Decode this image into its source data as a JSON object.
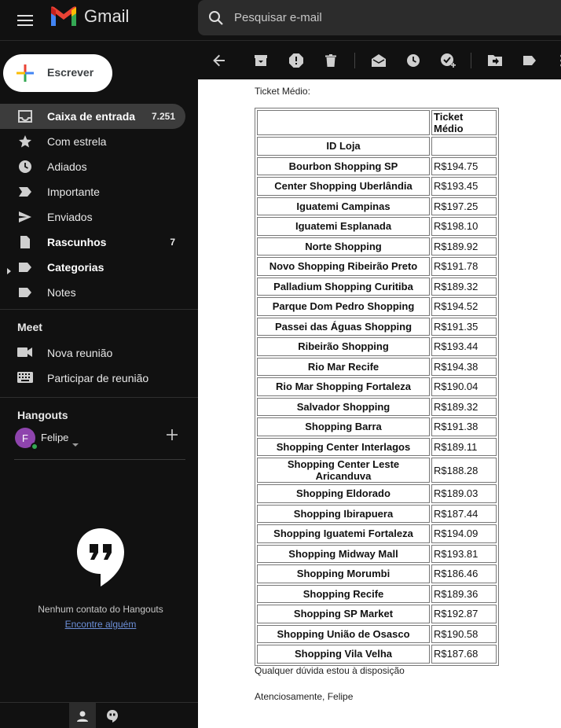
{
  "header": {
    "app_name": "Gmail",
    "search_placeholder": "Pesquisar e-mail"
  },
  "compose": {
    "label": "Escrever"
  },
  "nav": {
    "items": [
      {
        "label": "Caixa de entrada",
        "count": "7.251",
        "icon": "inbox-icon",
        "active": true,
        "bold": true
      },
      {
        "label": "Com estrela",
        "count": "",
        "icon": "star-icon"
      },
      {
        "label": "Adiados",
        "count": "",
        "icon": "clock-icon"
      },
      {
        "label": "Importante",
        "count": "",
        "icon": "important-icon"
      },
      {
        "label": "Enviados",
        "count": "",
        "icon": "send-icon"
      },
      {
        "label": "Rascunhos",
        "count": "7",
        "icon": "draft-icon",
        "bold": true
      },
      {
        "label": "Categorias",
        "count": "",
        "icon": "label-icon",
        "bold": true
      },
      {
        "label": "Notes",
        "count": "",
        "icon": "label-icon"
      }
    ]
  },
  "meet": {
    "title": "Meet",
    "new_meeting": "Nova reunião",
    "join_meeting": "Participar de reunião"
  },
  "hangouts": {
    "title": "Hangouts",
    "user_initial": "F",
    "user_name": "Felipe",
    "no_contacts": "Nenhum contato do Hangouts",
    "find_someone": "Encontre alguém"
  },
  "email": {
    "intro": "Ticket Médio:",
    "table_header_value": "Ticket Médio",
    "table_header_id": "ID Loja",
    "rows": [
      {
        "store": "Bourbon Shopping SP",
        "value": "R$194.75"
      },
      {
        "store": "Center Shopping Uberlândia",
        "value": "R$193.45"
      },
      {
        "store": "Iguatemi Campinas",
        "value": "R$197.25"
      },
      {
        "store": "Iguatemi Esplanada",
        "value": "R$198.10"
      },
      {
        "store": "Norte Shopping",
        "value": "R$189.92"
      },
      {
        "store": "Novo Shopping Ribeirão Preto",
        "value": "R$191.78"
      },
      {
        "store": "Palladium Shopping Curitiba",
        "value": "R$189.32"
      },
      {
        "store": "Parque Dom Pedro Shopping",
        "value": "R$194.52"
      },
      {
        "store": "Passei das Águas Shopping",
        "value": "R$191.35"
      },
      {
        "store": "Ribeirão Shopping",
        "value": "R$193.44"
      },
      {
        "store": "Rio Mar Recife",
        "value": "R$194.38"
      },
      {
        "store": "Rio Mar Shopping Fortaleza",
        "value": "R$190.04"
      },
      {
        "store": "Salvador Shopping",
        "value": "R$189.32"
      },
      {
        "store": "Shopping Barra",
        "value": "R$191.38"
      },
      {
        "store": "Shopping Center Interlagos",
        "value": "R$189.11"
      },
      {
        "store": "Shopping Center Leste Aricanduva",
        "value": "R$188.28"
      },
      {
        "store": "Shopping Eldorado",
        "value": "R$189.03"
      },
      {
        "store": "Shopping Ibirapuera",
        "value": "R$187.44"
      },
      {
        "store": "Shopping Iguatemi Fortaleza",
        "value": "R$194.09"
      },
      {
        "store": "Shopping Midway Mall",
        "value": "R$193.81"
      },
      {
        "store": "Shopping Morumbi",
        "value": "R$186.46"
      },
      {
        "store": "Shopping Recife",
        "value": "R$189.36"
      },
      {
        "store": "Shopping SP Market",
        "value": "R$192.87"
      },
      {
        "store": "Shopping União de Osasco",
        "value": "R$190.58"
      },
      {
        "store": "Shopping Vila Velha",
        "value": "R$187.68"
      }
    ],
    "closing_line": "Qualquer dúvida estou à disposição",
    "signature": "Atenciosamente, Felipe"
  },
  "colors": {
    "background": "#111111",
    "active_item": "#3c3c3c",
    "avatar": "#8e44ad",
    "online": "#34a853",
    "link": "#6c8fd8"
  }
}
